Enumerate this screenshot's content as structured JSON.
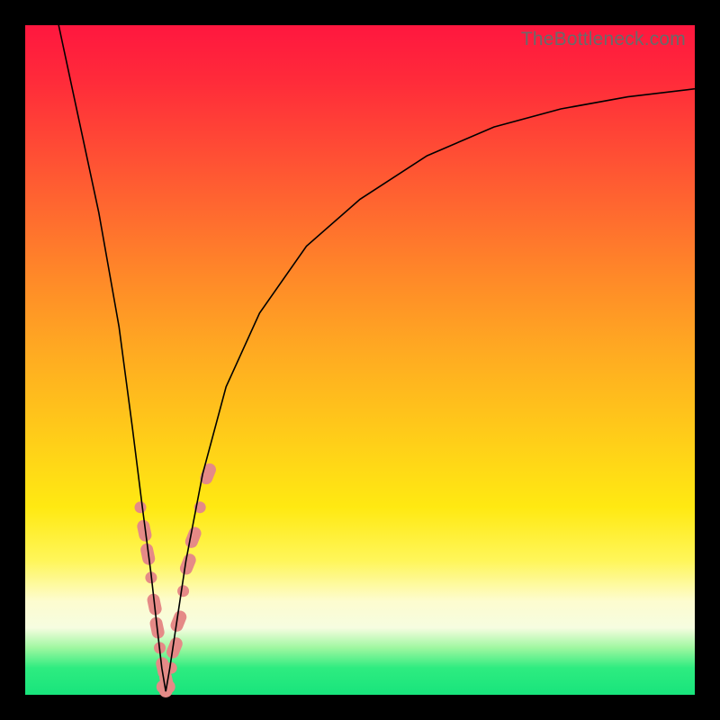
{
  "watermark": "TheBottleneck.com",
  "chart_data": {
    "type": "line",
    "title": "",
    "xlabel": "",
    "ylabel": "",
    "axes_visible": false,
    "grid": false,
    "legend": null,
    "xlim": [
      0,
      100
    ],
    "ylim": [
      0,
      100
    ],
    "background_gradient": {
      "direction": "vertical",
      "stops": [
        {
          "pos": 0,
          "color": "#ff173f"
        },
        {
          "pos": 50,
          "color": "#ffa822"
        },
        {
          "pos": 80,
          "color": "#fff65a"
        },
        {
          "pos": 92,
          "color": "#9ef7a0"
        },
        {
          "pos": 100,
          "color": "#18e47c"
        }
      ]
    },
    "series": [
      {
        "name": "bottleneck-curve",
        "stroke": "#000000",
        "stroke_width": 1.6,
        "notch_x": 21,
        "x": [
          5,
          8,
          11,
          14,
          16,
          17.5,
          18.8,
          19.7,
          20.4,
          21,
          21.6,
          22.5,
          24,
          26.5,
          30,
          35,
          42,
          50,
          60,
          70,
          80,
          90,
          100
        ],
        "y": [
          100,
          86,
          72,
          55,
          40,
          28,
          18,
          10,
          4,
          0.5,
          4,
          10,
          20,
          33,
          46,
          57,
          67,
          74,
          80.5,
          84.8,
          87.5,
          89.3,
          90.5
        ]
      },
      {
        "name": "left-arm-markers",
        "type": "scatter",
        "marker_color": "#e58a87",
        "marker_size_variant": "mixed-capsule",
        "x": [
          17.2,
          17.8,
          18.3,
          18.8,
          19.3,
          19.7,
          20.1,
          20.6,
          21.1
        ],
        "y": [
          28,
          24.5,
          21,
          17.5,
          13.5,
          10,
          7,
          4,
          2
        ]
      },
      {
        "name": "right-arm-markers",
        "type": "scatter",
        "marker_color": "#e58a87",
        "marker_size_variant": "mixed-capsule",
        "x": [
          21.8,
          22.3,
          22.9,
          23.6,
          24.3,
          25.1,
          26.1,
          27.3
        ],
        "y": [
          4,
          7,
          11,
          15.5,
          19.5,
          23.5,
          28,
          33
        ]
      },
      {
        "name": "valley-fill",
        "type": "scatter",
        "marker_color": "#e58a87",
        "marker_size_variant": "cluster",
        "x": [
          20.6,
          21.0,
          21.4
        ],
        "y": [
          1.2,
          0.6,
          1.2
        ]
      }
    ]
  }
}
